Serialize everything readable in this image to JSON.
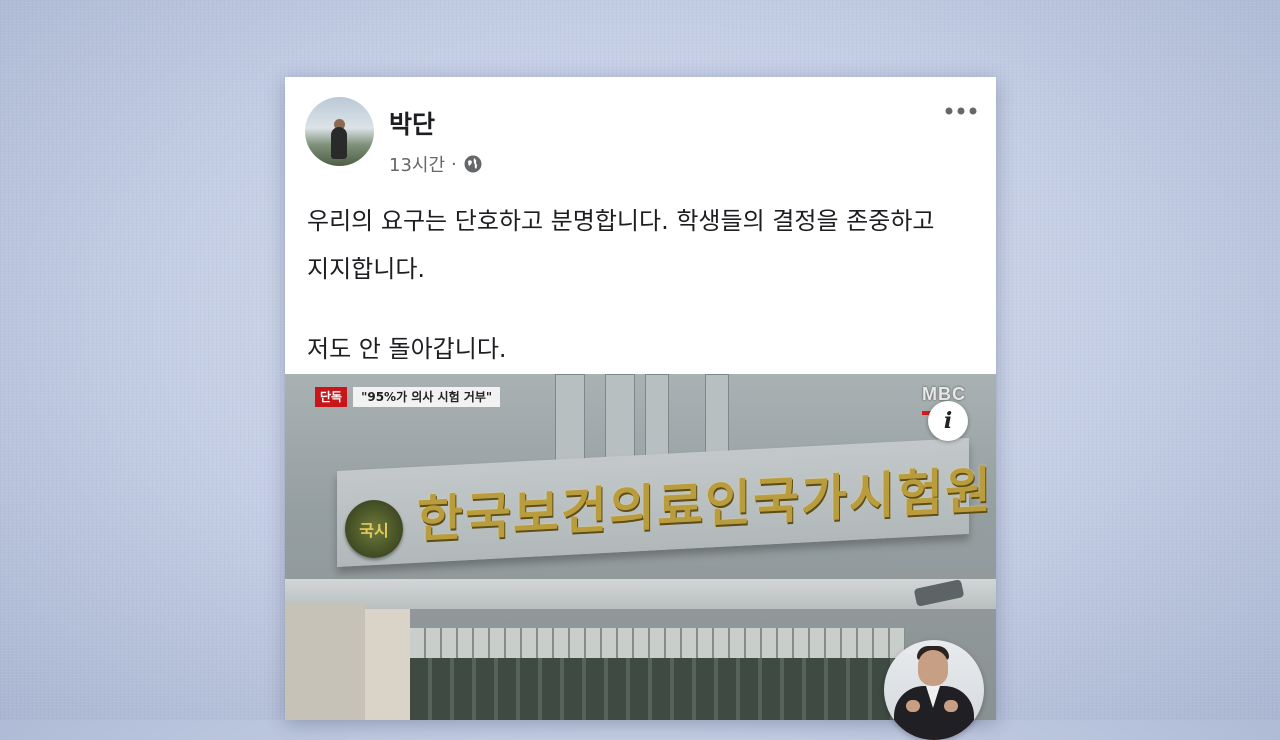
{
  "post": {
    "author": "박단",
    "time": "13시간",
    "separator": "·",
    "lines": [
      "우리의 요구는 단호하고 분명합니다. 학생들의 결정을 존중하고",
      "지지합니다.",
      "저도 안 돌아갑니다."
    ]
  },
  "media": {
    "badge_tag": "단독",
    "badge_headline": "\"95%가 의사 시험 거부\"",
    "channel_logo": "MBC",
    "sign_text": "한국보건의료인국가시험원",
    "emblem_text": "국시",
    "info_label": "i"
  },
  "icons": {
    "privacy": "globe-icon",
    "more": "more-horizontal-icon",
    "info": "info-icon"
  },
  "colors": {
    "badge_red": "#c8151a",
    "text_primary": "#1c1e21",
    "text_secondary": "#65676b"
  }
}
